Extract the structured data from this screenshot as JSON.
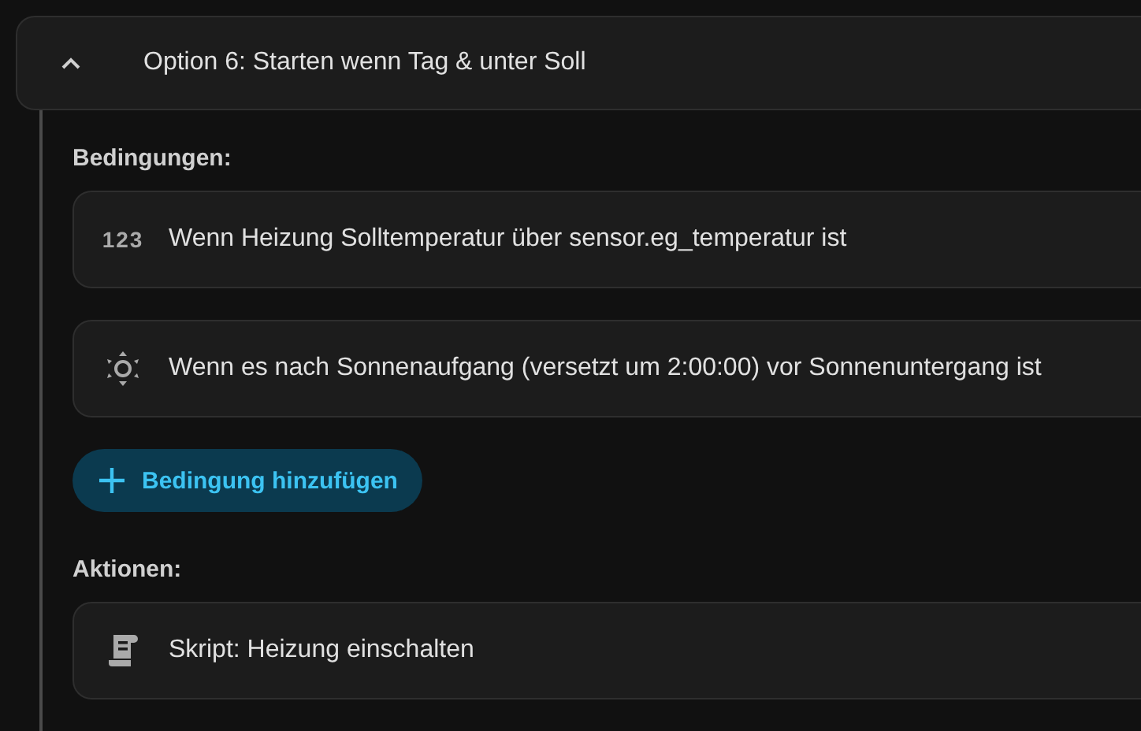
{
  "option": {
    "title": "Option 6: Starten wenn Tag & unter Soll",
    "expanded": true
  },
  "conditions_label": "Bedingungen:",
  "conditions": [
    {
      "kind": "numeric",
      "icon_text": "123",
      "text": "Wenn Heizung Solltemperatur über sensor.eg_temperatur ist"
    },
    {
      "kind": "sun",
      "text": "Wenn es nach Sonnenaufgang (versetzt um 2:00:00) vor Sonnenuntergang ist"
    }
  ],
  "add_button": "Bedingung hinzufügen",
  "actions_label": "Aktionen:",
  "actions": [
    {
      "kind": "script",
      "text": "Skript: Heizung einschalten"
    }
  ]
}
